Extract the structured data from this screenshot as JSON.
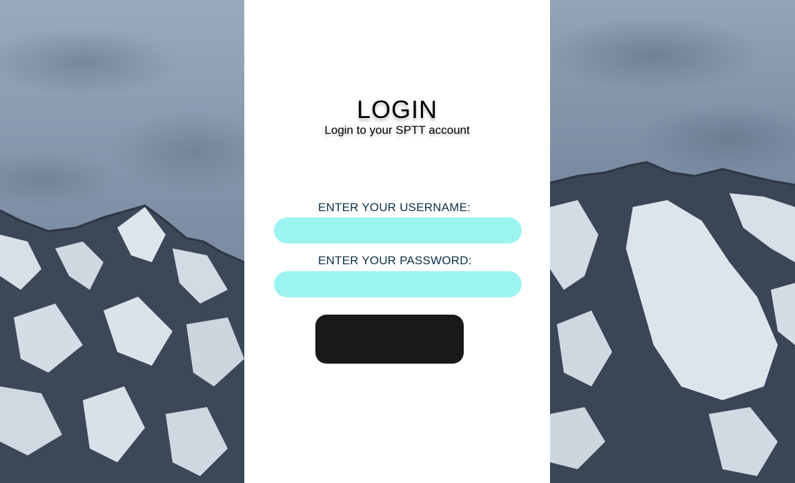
{
  "login": {
    "title": "LOGIN",
    "subtitle": "Login to your SPTT account",
    "username_label": "ENTER YOUR USERNAME:",
    "username_value": "",
    "password_label": "ENTER YOUR PASSWORD:",
    "password_value": "",
    "submit_label": ""
  },
  "colors": {
    "panel_background": "#ffffff",
    "field_background": "#9cf4f0",
    "label_text": "#0c2e45",
    "button_background": "#1b1917",
    "sky": "#8c9bb0",
    "rock": "#3a4656",
    "snow": "#dde4ec"
  },
  "background_image": "snowy-mountain-photo"
}
